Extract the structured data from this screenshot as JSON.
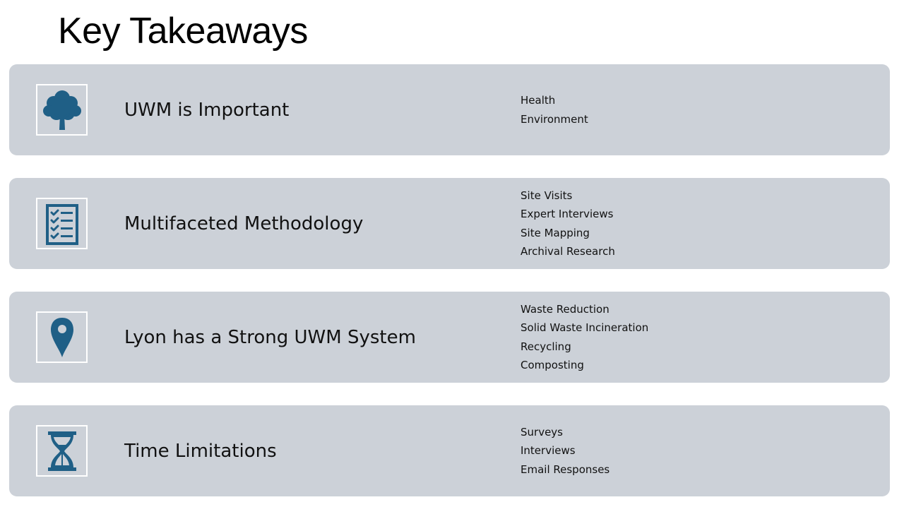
{
  "slide": {
    "title": "Key Takeaways"
  },
  "colors": {
    "card_background": "#ccd1d8",
    "icon_color": "#1f5f86",
    "icon_frame": "#ffffff"
  },
  "cards": [
    {
      "icon": "tree-icon",
      "title": "UWM is Important",
      "details": [
        "Health",
        "Environment"
      ]
    },
    {
      "icon": "checklist-icon",
      "title": "Multifaceted Methodology",
      "details": [
        "Site Visits",
        "Expert Interviews",
        "Site Mapping",
        "Archival Research"
      ]
    },
    {
      "icon": "map-pin-icon",
      "title": "Lyon has a Strong UWM System",
      "details": [
        "Waste Reduction",
        "Solid Waste Incineration",
        "Recycling",
        "Composting"
      ]
    },
    {
      "icon": "hourglass-icon",
      "title": "Time Limitations",
      "details": [
        "Surveys",
        "Interviews",
        "Email Responses"
      ]
    }
  ]
}
